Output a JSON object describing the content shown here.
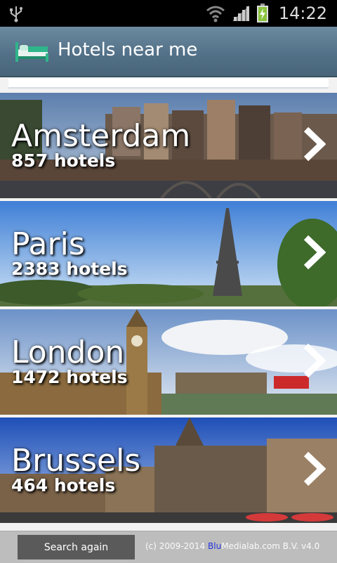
{
  "status_bar": {
    "time": "14:22"
  },
  "app_bar": {
    "title": "Hotels near me"
  },
  "cities": [
    {
      "name": "Amsterdam",
      "count": "857 hotels"
    },
    {
      "name": "Paris",
      "count": "2383 hotels"
    },
    {
      "name": "London",
      "count": "1472 hotels"
    },
    {
      "name": "Brussels",
      "count": "464 hotels"
    }
  ],
  "footer": {
    "search_again": "Search again",
    "copyright": "(c) 2009-2014",
    "brand_blu": "Blu",
    "brand_rest": "Medialab.com B.V. v4.0"
  },
  "colors": {
    "action_bar": "#516f86",
    "bottom_bar": "#bdbdbd",
    "button": "#5a5a5a",
    "brand_blu": "#2233dd"
  },
  "icons": [
    "usb-icon",
    "wifi-icon",
    "signal-icon",
    "battery-icon",
    "hotel-bed-icon",
    "chevron-right-icon"
  ]
}
